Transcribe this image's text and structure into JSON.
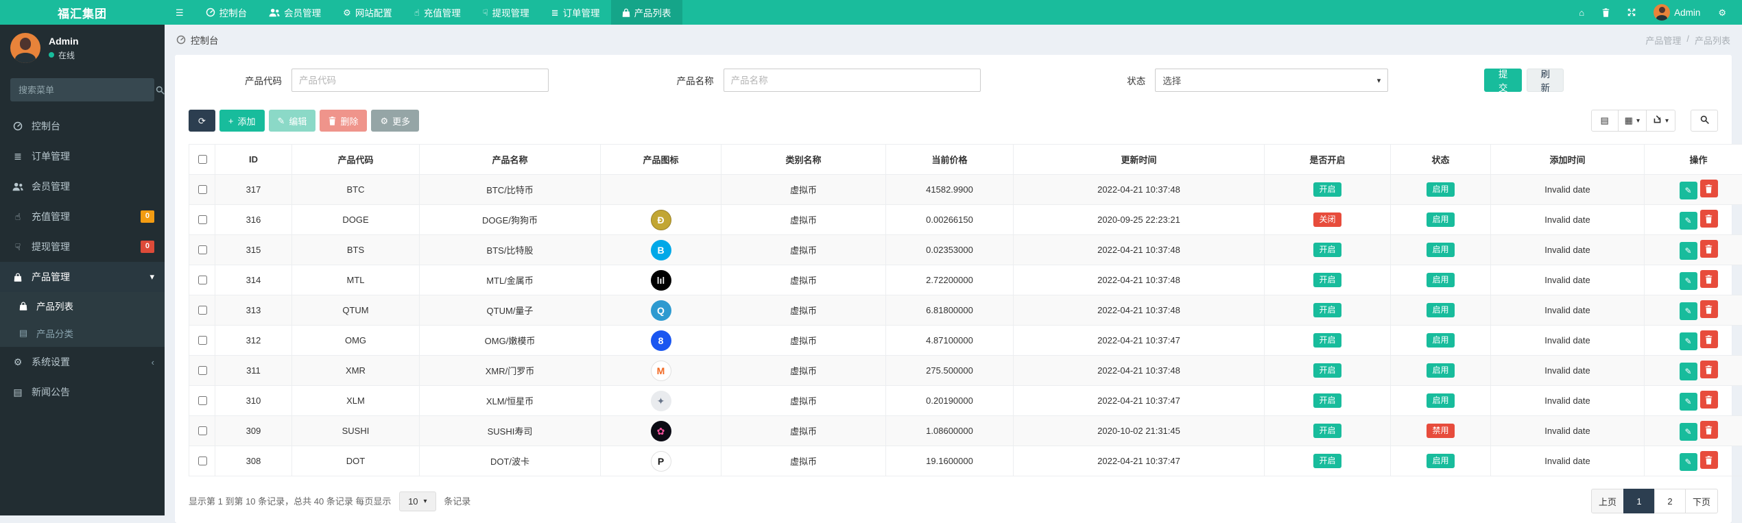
{
  "brand": {
    "title": "福汇集团"
  },
  "topnav": {
    "items": [
      {
        "label": "控制台",
        "icon": "dashboard"
      },
      {
        "label": "会员管理",
        "icon": "users"
      },
      {
        "label": "网站配置",
        "icon": "gear"
      },
      {
        "label": "充值管理",
        "icon": "hand-up"
      },
      {
        "label": "提现管理",
        "icon": "hand-down"
      },
      {
        "label": "订单管理",
        "icon": "list"
      },
      {
        "label": "产品列表",
        "icon": "bag",
        "active": true
      }
    ],
    "right_icons": [
      "home",
      "trash",
      "expand"
    ],
    "user": {
      "name": "Admin"
    },
    "settings_icon": "gear"
  },
  "sidebar": {
    "user": {
      "name": "Admin",
      "status": "在线"
    },
    "search_placeholder": "搜索菜单",
    "items": [
      {
        "label": "控制台",
        "icon": "dashboard"
      },
      {
        "label": "订单管理",
        "icon": "list"
      },
      {
        "label": "会员管理",
        "icon": "users"
      },
      {
        "label": "充值管理",
        "icon": "hand-up",
        "badge": "0",
        "badge_color": "#f39c12"
      },
      {
        "label": "提现管理",
        "icon": "hand-down",
        "badge": "0",
        "badge_color": "#dd4b39"
      },
      {
        "label": "产品管理",
        "icon": "bag",
        "arrow": "down",
        "active_parent": true,
        "children": [
          {
            "label": "产品列表",
            "icon": "bag",
            "active": true
          },
          {
            "label": "产品分类",
            "icon": "newspaper",
            "active": false
          }
        ]
      },
      {
        "label": "系统设置",
        "icon": "gear",
        "arrow": "left"
      },
      {
        "label": "新闻公告",
        "icon": "newspaper"
      }
    ]
  },
  "breadcrumb": {
    "left": "控制台",
    "right": [
      "产品管理",
      "产品列表"
    ],
    "separator": "/"
  },
  "filters": {
    "code_label": "产品代码",
    "code_placeholder": "产品代码",
    "name_label": "产品名称",
    "name_placeholder": "产品名称",
    "status_label": "状态",
    "status_value": "选择",
    "submit_label": "提交",
    "refresh_label": "刷新"
  },
  "toolbar": {
    "add_label": "添加",
    "edit_label": "编辑",
    "delete_label": "删除",
    "more_label": "更多"
  },
  "table": {
    "headers": [
      "ID",
      "产品代码",
      "产品名称",
      "产品图标",
      "类别名称",
      "当前价格",
      "更新时间",
      "是否开启",
      "状态",
      "添加时间",
      "操作"
    ],
    "rows": [
      {
        "id": "317",
        "code": "BTC",
        "name": "BTC/比特币",
        "icon": null,
        "category": "虚拟币",
        "price": "41582.9900",
        "updated": "2022-04-21 10:37:48",
        "open": "开启",
        "open_state": "on",
        "status": "启用",
        "status_state": "on",
        "added": "Invalid date"
      },
      {
        "id": "316",
        "code": "DOGE",
        "name": "DOGE/狗狗币",
        "icon": {
          "name": "doge-icon",
          "glyph": "Ð",
          "bg": "#c2a633",
          "fg": "#ffffff",
          "border": "#9a8226"
        },
        "category": "虚拟币",
        "price": "0.00266150",
        "updated": "2020-09-25 22:23:21",
        "open": "关闭",
        "open_state": "off",
        "status": "启用",
        "status_state": "on",
        "added": "Invalid date"
      },
      {
        "id": "315",
        "code": "BTS",
        "name": "BTS/比特股",
        "icon": {
          "name": "bts-icon",
          "glyph": "B",
          "bg": "#00a8e8",
          "fg": "#ffffff",
          "border": ""
        },
        "category": "虚拟币",
        "price": "0.02353000",
        "updated": "2022-04-21 10:37:48",
        "open": "开启",
        "open_state": "on",
        "status": "启用",
        "status_state": "on",
        "added": "Invalid date"
      },
      {
        "id": "314",
        "code": "MTL",
        "name": "MTL/金属币",
        "icon": {
          "name": "mtl-icon",
          "glyph": "ǀıǀ",
          "bg": "#000000",
          "fg": "#ffffff",
          "border": ""
        },
        "category": "虚拟币",
        "price": "2.72200000",
        "updated": "2022-04-21 10:37:48",
        "open": "开启",
        "open_state": "on",
        "status": "启用",
        "status_state": "on",
        "added": "Invalid date"
      },
      {
        "id": "313",
        "code": "QTUM",
        "name": "QTUM/量子",
        "icon": {
          "name": "qtum-icon",
          "glyph": "Q",
          "bg": "#2e9ad0",
          "fg": "#ffffff",
          "border": ""
        },
        "category": "虚拟币",
        "price": "6.81800000",
        "updated": "2022-04-21 10:37:48",
        "open": "开启",
        "open_state": "on",
        "status": "启用",
        "status_state": "on",
        "added": "Invalid date"
      },
      {
        "id": "312",
        "code": "OMG",
        "name": "OMG/嫩模币",
        "icon": {
          "name": "omg-icon",
          "glyph": "8",
          "bg": "#1a56f0",
          "fg": "#ffffff",
          "border": ""
        },
        "category": "虚拟币",
        "price": "4.87100000",
        "updated": "2022-04-21 10:37:47",
        "open": "开启",
        "open_state": "on",
        "status": "启用",
        "status_state": "on",
        "added": "Invalid date"
      },
      {
        "id": "311",
        "code": "XMR",
        "name": "XMR/门罗币",
        "icon": {
          "name": "xmr-icon",
          "glyph": "M",
          "bg": "#ffffff",
          "fg": "#f26822",
          "border": "#e0e0e0"
        },
        "category": "虚拟币",
        "price": "275.500000",
        "updated": "2022-04-21 10:37:48",
        "open": "开启",
        "open_state": "on",
        "status": "启用",
        "status_state": "on",
        "added": "Invalid date"
      },
      {
        "id": "310",
        "code": "XLM",
        "name": "XLM/恒星币",
        "icon": {
          "name": "xlm-icon",
          "glyph": "✦",
          "bg": "#e9ebee",
          "fg": "#68758a",
          "border": ""
        },
        "category": "虚拟币",
        "price": "0.20190000",
        "updated": "2022-04-21 10:37:47",
        "open": "开启",
        "open_state": "on",
        "status": "启用",
        "status_state": "on",
        "added": "Invalid date"
      },
      {
        "id": "309",
        "code": "SUSHI",
        "name": "SUSHI寿司",
        "icon": {
          "name": "sushi-icon",
          "glyph": "✿",
          "bg": "#0b0b14",
          "fg": "#fa52a0",
          "border": ""
        },
        "category": "虚拟币",
        "price": "1.08600000",
        "updated": "2020-10-02 21:31:45",
        "open": "开启",
        "open_state": "on",
        "status": "禁用",
        "status_state": "off",
        "added": "Invalid date"
      },
      {
        "id": "308",
        "code": "DOT",
        "name": "DOT/波卡",
        "icon": {
          "name": "dot-icon",
          "glyph": "P",
          "bg": "#ffffff",
          "fg": "#1b1b1b",
          "border": "#e0e0e0"
        },
        "category": "虚拟币",
        "price": "19.1600000",
        "updated": "2022-04-21 10:37:47",
        "open": "开启",
        "open_state": "on",
        "status": "启用",
        "status_state": "on",
        "added": "Invalid date"
      }
    ]
  },
  "footer": {
    "summary_prefix": "显示第 1 到第 10 条记录，总共 40 条记录 每页显示",
    "page_size": "10",
    "summary_suffix": "条记录",
    "pagination": {
      "prev": "上页",
      "pages": [
        "1",
        "2"
      ],
      "active": "1",
      "next": "下页"
    }
  },
  "colors": {
    "accent": "#1abc9c",
    "dark": "#2c3e50",
    "danger": "#e74c3c",
    "warning": "#f39c12",
    "sidebar": "#222d32"
  }
}
